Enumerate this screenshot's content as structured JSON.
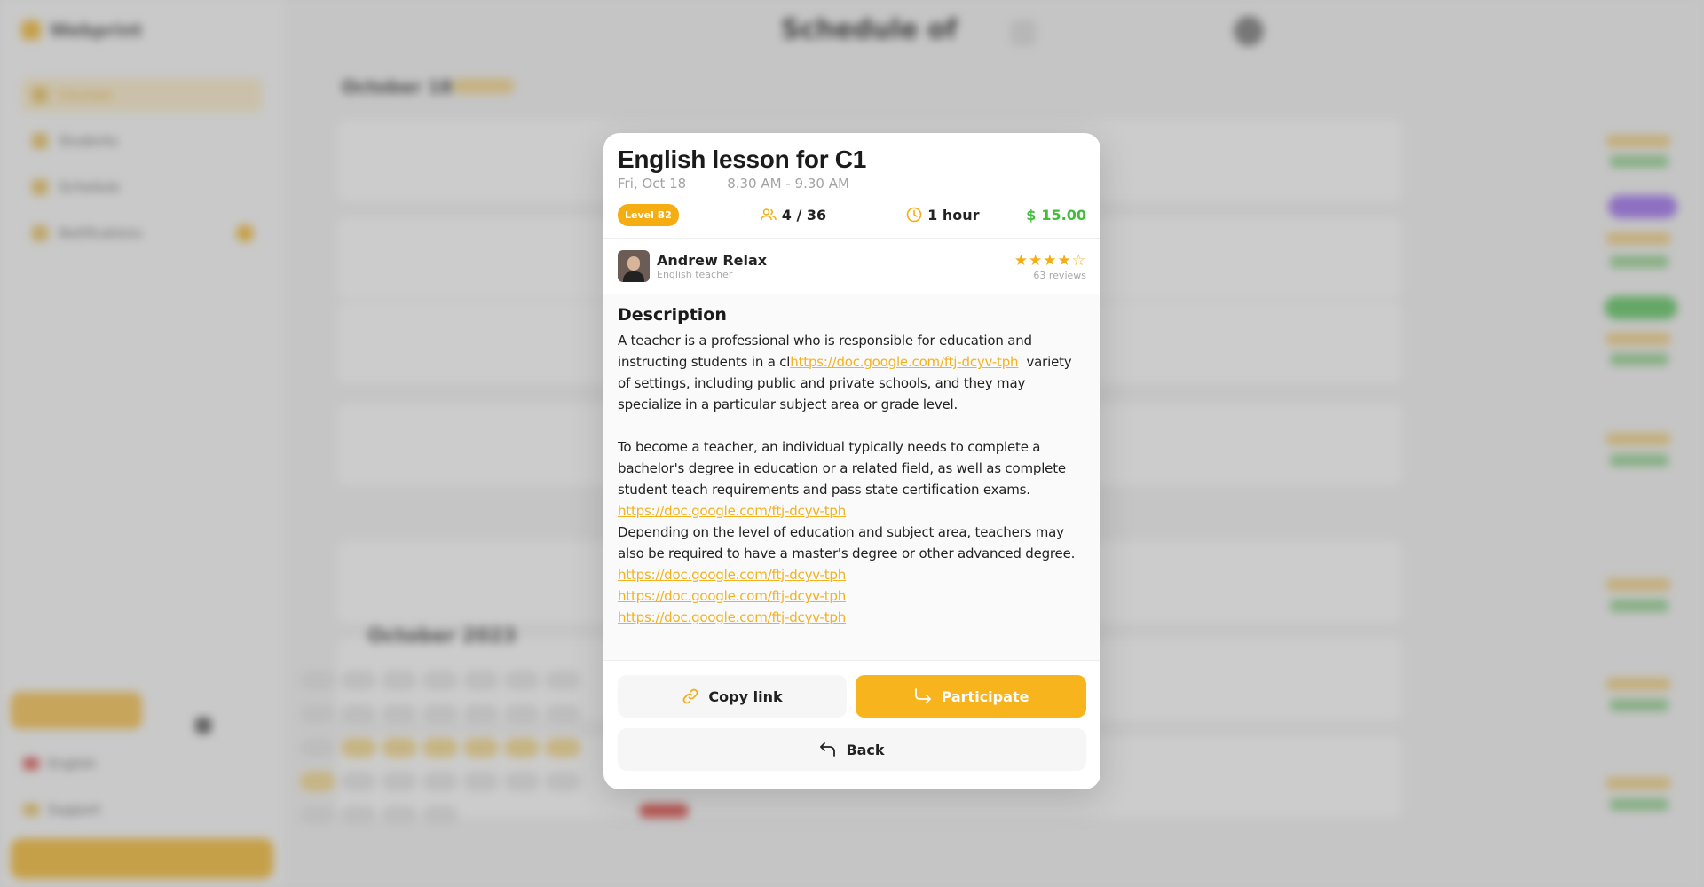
{
  "background": {
    "logo_text": "Webprint",
    "nav": [
      "Courses",
      "Students",
      "Schedule",
      "Notifications"
    ],
    "page_title": "Schedule of",
    "date_header": "October 18th",
    "calendar_title": "October 2023",
    "side_lines": [
      "English",
      "Support"
    ]
  },
  "modal": {
    "title": "English lesson for C1",
    "date": "Fri, Oct 18",
    "time": "8.30 AM - 9.30 AM",
    "level": "Level B2",
    "seats": "4 / 36",
    "duration": "1 hour",
    "price": "15.00",
    "teacher": {
      "name": "Andrew Relax",
      "role": "English teacher",
      "rating": 4,
      "reviews": "63 reviews"
    },
    "description": {
      "heading": "Description",
      "p1_before": "A teacher is a professional who is responsible for education and instructing students in a cl",
      "p1_link": "https://doc.google.com/ftj-dcyv-tph",
      "p1_after": "  variety of settings, including public and private schools, and they may specialize in a particular subject area or grade level.",
      "p2": "To become a teacher, an individual typically needs to complete a bachelor's degree in education or a related field, as well as complete student teach requirements and pass state certification exams.",
      "link1": "https://doc.google.com/ftj-dcyv-tph",
      "p3": "Depending on the level of education and subject area, teachers may also be required to have a master's degree or other advanced degree.",
      "links": [
        "https://doc.google.com/ftj-dcyv-tph",
        "https://doc.google.com/ftj-dcyv-tph",
        "https://doc.google.com/ftj-dcyv-tph"
      ]
    },
    "buttons": {
      "copy": "Copy link",
      "participate": "Participate",
      "back": "Back"
    },
    "colors": {
      "accent": "#f8b41d",
      "price": "#3fbf39"
    }
  }
}
